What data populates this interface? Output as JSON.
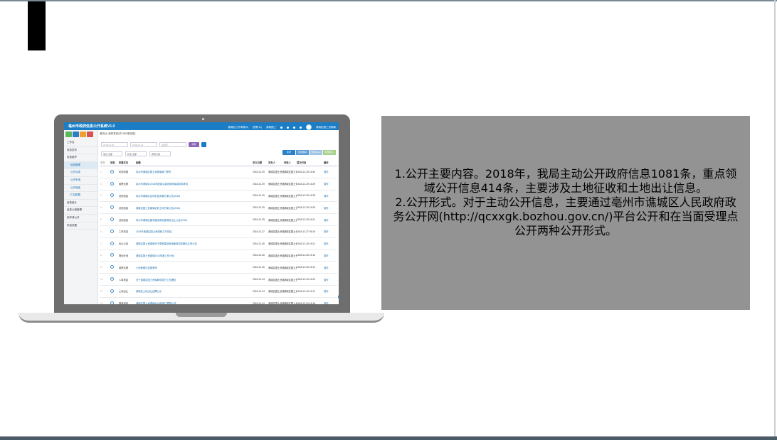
{
  "app": {
    "title": "亳州市政府信息公开系统V1.0",
    "header_links": [
      "谯城区公开审核(9)",
      "投票(11)",
      "谯城国土"
    ],
    "user": "谯城区国土资源局"
  },
  "sidebar": {
    "items": [
      {
        "label": "工作台"
      },
      {
        "label": "信息发布"
      },
      {
        "label": "信息维护"
      },
      {
        "label": "信息管理"
      },
      {
        "label": "公开目录"
      },
      {
        "label": "公开申请"
      },
      {
        "label": "公开指南"
      },
      {
        "label": "栏目配置"
      },
      {
        "label": "信息统计"
      },
      {
        "label": "信息公报管理"
      },
      {
        "label": "依申请公开"
      },
      {
        "label": "系统设置"
      }
    ]
  },
  "content": {
    "breadcrumb": "首页(0)  我的发布(共1081条信息)",
    "date_from": "2018-01-01",
    "date_to": "2018-12-31",
    "keyword_placeholder": "关键字",
    "search_label": "搜索",
    "select_1": "信息 全部",
    "select_2": "状态 全部",
    "select_3": "所有分类",
    "actions": [
      "新增",
      "批量删除",
      "导出Excel",
      "批量导入"
    ],
    "columns": [
      "序号",
      "状态",
      "所属栏目",
      "标题",
      "发文日期",
      "发布人",
      "审核人",
      "提交时间",
      "操作"
    ],
    "rows": [
      {
        "index": "1",
        "category": "机构设置",
        "title": "亳州市谯城区国土资源局部门职责",
        "date": "2018-12-29",
        "publisher": "谯城区国土资源局",
        "reviewer": "谯城区国土资源局",
        "time": "2018-12-29 16:30",
        "op": "操作"
      },
      {
        "index": "2",
        "category": "政策法规",
        "title": "亳州市谯城区2018年度城乡建设用地增减挂钩项目",
        "date": "2018-12-29",
        "publisher": "谯城区国土资源局",
        "reviewer": "谯城区国土资源局",
        "time": "2018-12-29 16:29",
        "op": "操作"
      },
      {
        "index": "3",
        "category": "征地信息",
        "title": "亳州市谯城区征地补偿安置方案公告(2018)",
        "date": "2018-12-29",
        "publisher": "谯城区国土资源局",
        "reviewer": "谯城区国土资源局",
        "time": "2018-12-29 16:28",
        "op": "操作"
      },
      {
        "index": "4",
        "category": "征地信息",
        "title": "谯城区国土资源局征收土地方案公告(2018)",
        "date": "2018-12-29",
        "publisher": "谯城区国土资源局",
        "reviewer": "谯城区国土资源局",
        "time": "2018-12-29 16:25",
        "op": "操作"
      },
      {
        "index": "5",
        "category": "征地信息",
        "title": "亳州市谯城区国有建设用地使用权出让公告(2018)",
        "date": "2018-12-29",
        "publisher": "谯城区国土资源局",
        "reviewer": "谯城区国土资源局",
        "time": "2018-12-29 16:21",
        "op": "操作"
      },
      {
        "index": "6",
        "category": "工作动态",
        "title": "2018年谯城区国土资源局工作总结",
        "date": "2018-12-27",
        "publisher": "谯城区国土资源局",
        "reviewer": "谯城区国土资源局",
        "time": "2018-12-27 09:19",
        "op": "操作"
      },
      {
        "index": "7",
        "category": "出让公告",
        "title": "谯城区国土资源局关于国有建设用地使用权挂牌出让的公告",
        "date": "2018-12-26",
        "publisher": "谯城区国土资源局",
        "reviewer": "谯城区国土资源局",
        "time": "2018-12-26 16:21",
        "op": "操作"
      },
      {
        "index": "8",
        "category": "规划计划",
        "title": "谯城区国土资源局2018年度工作计划",
        "date": "2018-12-26",
        "publisher": "谯城区国土资源局",
        "reviewer": "谯城区国土资源局",
        "time": "2018-12-26 15:13",
        "op": "操作"
      },
      {
        "index": "9",
        "category": "政策法规",
        "title": "土地管理法实施条例",
        "date": "2018-12-26",
        "publisher": "谯城区国土资源局",
        "reviewer": "谯城区国土资源局",
        "time": "2018-12-26 15:10",
        "op": "操作"
      },
      {
        "index": "10",
        "category": "人事信息",
        "title": "关于谯城区国土资源局领导分工的通知",
        "date": "2018-12-24",
        "publisher": "谯城区国土资源局",
        "reviewer": "谯城区国土资源局",
        "time": "2018-12-24 16:22",
        "op": "操作"
      },
      {
        "index": "11",
        "category": "土地出让",
        "title": "谯城区土地出让结果公示",
        "date": "2018-12-24",
        "publisher": "谯城区国土资源局",
        "reviewer": "谯城区国土资源局",
        "time": "2018-12-24 16:17",
        "op": "操作"
      },
      {
        "index": "12",
        "category": "财政资金",
        "title": "谯城区国土资源局2018年部门预算公开",
        "date": "2018-12-24",
        "publisher": "谯城区国土资源局",
        "reviewer": "谯城区国土资源局",
        "time": "2018-12-24 16:15",
        "op": "操作"
      }
    ]
  },
  "info_panel": {
    "paragraphs": [
      "1.公开主要内容。2018年，我局主动公开政府信息1081条，重点领域公开信息414条，主要涉及土地征收和土地出让信息。",
      "2.公开形式。对于主动公开信息，主要通过亳州市谯城区人民政府政务公开网(http://qcxxgk.bozhou.gov.cn/)平台公开和在当面受理点公开两种公开形式。"
    ]
  },
  "colors": {
    "header_blue": "#1a7dc5",
    "panel_gray": "#939393",
    "laptop_gray": "#6e6e6e"
  }
}
